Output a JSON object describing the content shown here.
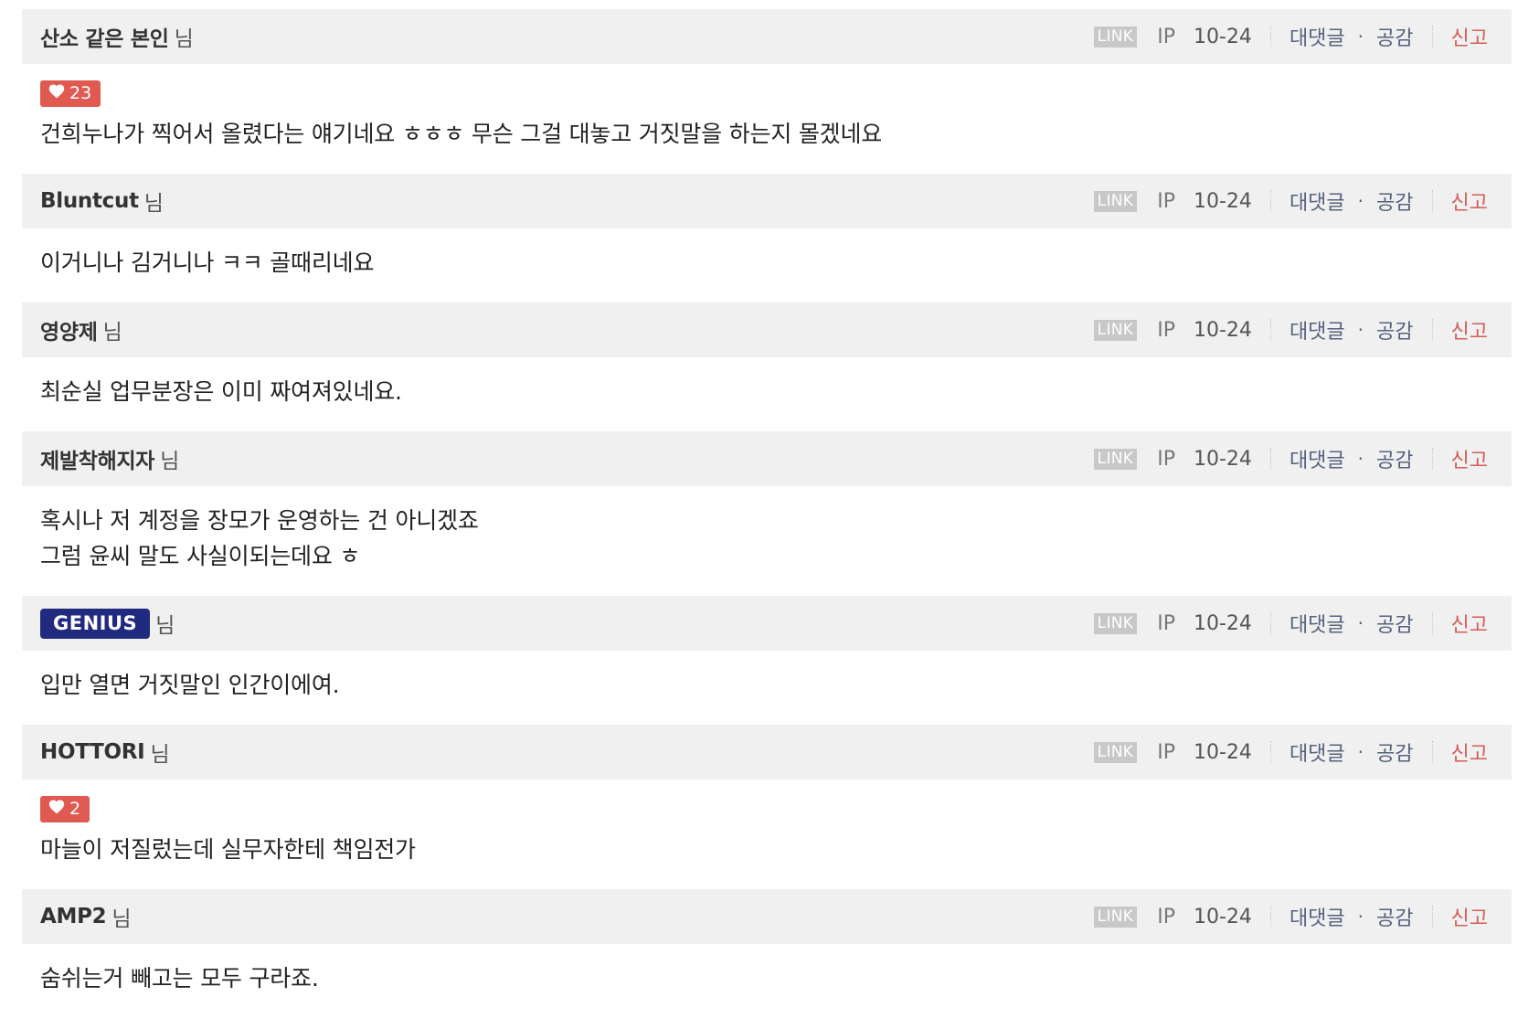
{
  "meta_labels": {
    "link": "LINK",
    "ip": "IP",
    "reply": "대댓글",
    "dot": "·",
    "like": "공감",
    "report": "신고",
    "suffix": "님"
  },
  "icons": {
    "heart": "heart-icon"
  },
  "colors": {
    "header_bg": "#f0f0f0",
    "like_badge": "#e05a52",
    "report": "#d55d57",
    "action": "#55627e",
    "genius_badge": "#202a7f"
  },
  "comments": [
    {
      "author": "산소 같은 본인",
      "date": "10-24",
      "likes": "23",
      "text": "건희누나가 찍어서 올렸다는 얘기네요 ㅎㅎㅎ 무슨 그걸 대놓고 거짓말을 하는지 몰겠네요"
    },
    {
      "author": "Bluntcut",
      "date": "10-24",
      "text": "이거니나 김거니나 ㅋㅋ 골때리네요"
    },
    {
      "author": "영양제",
      "date": "10-24",
      "text": "최순실 업무분장은 이미 짜여져있네요."
    },
    {
      "author": "제발착해지자",
      "date": "10-24",
      "text": "혹시나 저 계정을 장모가 운영하는 건 아니겠죠\n그럼 윤씨 말도 사실이되는데요 ㅎ"
    },
    {
      "author": "GENIUS",
      "author_is_badge": true,
      "date": "10-24",
      "text": "입만 열면 거짓말인 인간이에여."
    },
    {
      "author": "HOTTORI",
      "date": "10-24",
      "likes": "2",
      "text": "마늘이 저질렀는데 실무자한테 책임전가"
    },
    {
      "author": "AMP2",
      "date": "10-24",
      "text": "숨쉬는거 빼고는 모두 구라죠."
    }
  ]
}
